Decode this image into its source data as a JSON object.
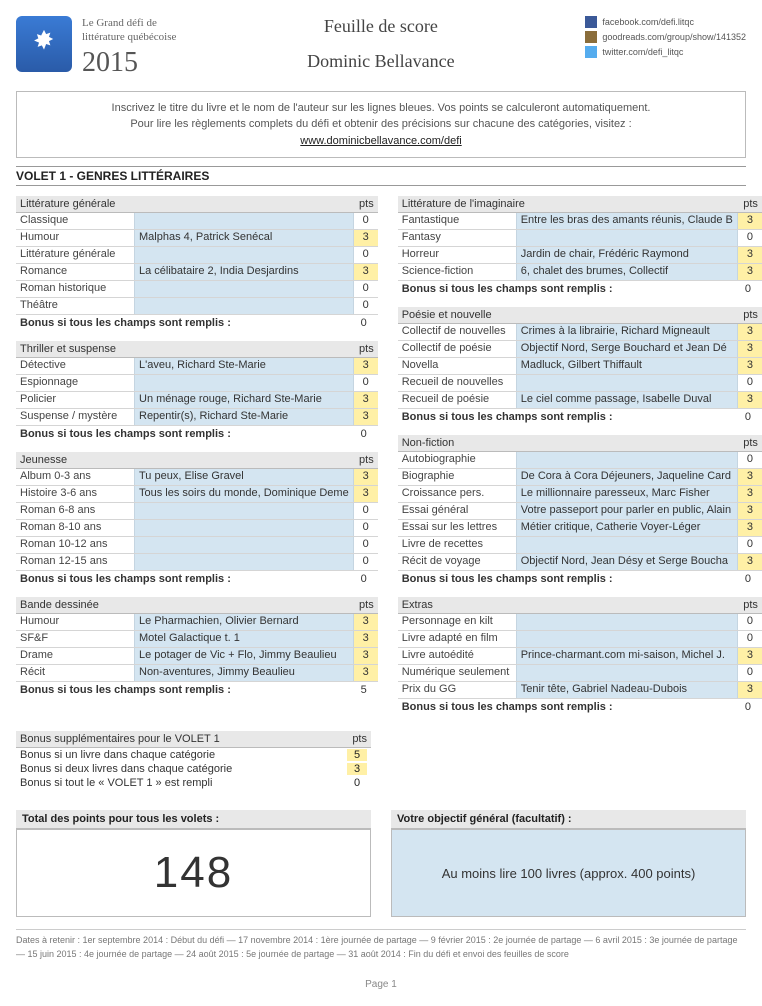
{
  "header": {
    "title1": "Le Grand défi de",
    "title2": "littérature québécoise",
    "year": "2015",
    "subtitle": "Feuille de score",
    "name": "Dominic Bellavance",
    "social": [
      {
        "icon": "fb",
        "text": "facebook.com/defi.litqc"
      },
      {
        "icon": "gr",
        "text": "goodreads.com/group/show/141352"
      },
      {
        "icon": "tw",
        "text": "twitter.com/defi_litqc"
      }
    ]
  },
  "notice": {
    "l1": "Inscrivez le titre du livre et le nom de l'auteur sur les lignes bleues. Vos points se calculeront automatiquement.",
    "l2": "Pour lire les règlements complets du défi et obtenir des précisions sur chacune des catégories, visitez :",
    "url": "www.dominicbellavance.com/defi"
  },
  "volet": "VOLET 1 - GENRES LITTÉRAIRES",
  "pts_label": "pts",
  "bonus_label": "Bonus si tous les champs sont remplis :",
  "left": [
    {
      "name": "Littérature générale",
      "rows": [
        {
          "label": "Classique",
          "val": "",
          "pts": "0"
        },
        {
          "label": "Humour",
          "val": "Malphas 4, Patrick Senécal",
          "pts": "3",
          "hl": true
        },
        {
          "label": "Littérature générale",
          "val": "",
          "pts": "0"
        },
        {
          "label": "Romance",
          "val": "La célibataire 2, India Desjardins",
          "pts": "3",
          "hl": true
        },
        {
          "label": "Roman historique",
          "val": "",
          "pts": "0"
        },
        {
          "label": "Théâtre",
          "val": "",
          "pts": "0"
        }
      ],
      "bonus": "0"
    },
    {
      "name": "Thriller et suspense",
      "rows": [
        {
          "label": "Détective",
          "val": "L'aveu, Richard Ste-Marie",
          "pts": "3",
          "hl": true
        },
        {
          "label": "Espionnage",
          "val": "",
          "pts": "0"
        },
        {
          "label": "Policier",
          "val": "Un ménage rouge, Richard Ste-Marie",
          "pts": "3",
          "hl": true
        },
        {
          "label": "Suspense / mystère",
          "val": "Repentir(s), Richard Ste-Marie",
          "pts": "3",
          "hl": true
        }
      ],
      "bonus": "0"
    },
    {
      "name": "Jeunesse",
      "rows": [
        {
          "label": "Album 0-3 ans",
          "val": "Tu peux, Elise Gravel",
          "pts": "3",
          "hl": true
        },
        {
          "label": "Histoire 3-6 ans",
          "val": "Tous les soirs du monde, Dominique Deme",
          "pts": "3",
          "hl": true
        },
        {
          "label": "Roman 6-8 ans",
          "val": "",
          "pts": "0"
        },
        {
          "label": "Roman 8-10 ans",
          "val": "",
          "pts": "0"
        },
        {
          "label": "Roman 10-12 ans",
          "val": "",
          "pts": "0"
        },
        {
          "label": "Roman 12-15 ans",
          "val": "",
          "pts": "0"
        }
      ],
      "bonus": "0"
    },
    {
      "name": "Bande dessinée",
      "rows": [
        {
          "label": "Humour",
          "val": "Le Pharmachien, Olivier Bernard",
          "pts": "3",
          "hl": true
        },
        {
          "label": "SF&F",
          "val": "Motel Galactique t. 1",
          "pts": "3",
          "hl": true
        },
        {
          "label": "Drame",
          "val": "Le potager de Vic + Flo, Jimmy Beaulieu",
          "pts": "3",
          "hl": true
        },
        {
          "label": "Récit",
          "val": "Non-aventures, Jimmy Beaulieu",
          "pts": "3",
          "hl": true
        }
      ],
      "bonus": "5"
    }
  ],
  "right": [
    {
      "name": "Littérature de l'imaginaire",
      "rows": [
        {
          "label": "Fantastique",
          "val": "Entre les bras des amants réunis, Claude B",
          "pts": "3",
          "hl": true
        },
        {
          "label": "Fantasy",
          "val": "",
          "pts": "0"
        },
        {
          "label": "Horreur",
          "val": "Jardin de chair, Frédéric Raymond",
          "pts": "3",
          "hl": true
        },
        {
          "label": "Science-fiction",
          "val": "6, chalet des brumes, Collectif",
          "pts": "3",
          "hl": true
        }
      ],
      "bonus": "0"
    },
    {
      "name": "Poésie et nouvelle",
      "rows": [
        {
          "label": "Collectif de nouvelles",
          "val": "Crimes à la librairie, Richard Migneault",
          "pts": "3",
          "hl": true
        },
        {
          "label": "Collectif de poésie",
          "val": "Objectif Nord, Serge Bouchard et Jean Dé",
          "pts": "3",
          "hl": true
        },
        {
          "label": "Novella",
          "val": "Madluck, Gilbert Thiffault",
          "pts": "3",
          "hl": true
        },
        {
          "label": "Recueil de nouvelles",
          "val": "",
          "pts": "0"
        },
        {
          "label": "Recueil de poésie",
          "val": "Le ciel comme passage, Isabelle Duval",
          "pts": "3",
          "hl": true
        }
      ],
      "bonus": "0"
    },
    {
      "name": "Non-fiction",
      "rows": [
        {
          "label": "Autobiographie",
          "val": "",
          "pts": "0"
        },
        {
          "label": "Biographie",
          "val": "De Cora à Cora Déjeuners, Jaqueline Card",
          "pts": "3",
          "hl": true
        },
        {
          "label": "Croissance pers.",
          "val": "Le millionnaire paresseux, Marc Fisher",
          "pts": "3",
          "hl": true
        },
        {
          "label": "Essai général",
          "val": "Votre passeport pour parler en public, Alain",
          "pts": "3",
          "hl": true
        },
        {
          "label": "Essai sur les lettres",
          "val": "Métier critique, Catherie Voyer-Léger",
          "pts": "3",
          "hl": true
        },
        {
          "label": "Livre de recettes",
          "val": "",
          "pts": "0"
        },
        {
          "label": "Récit de voyage",
          "val": "Objectif Nord, Jean Désy et Serge Boucha",
          "pts": "3",
          "hl": true
        }
      ],
      "bonus": "0"
    },
    {
      "name": "Extras",
      "rows": [
        {
          "label": "Personnage en kilt",
          "val": "",
          "pts": "0"
        },
        {
          "label": "Livre adapté en film",
          "val": "",
          "pts": "0"
        },
        {
          "label": "Livre autoédité",
          "val": "Prince-charmant.com mi-saison, Michel J.",
          "pts": "3",
          "hl": true
        },
        {
          "label": "Numérique seulement",
          "val": "",
          "pts": "0"
        },
        {
          "label": "Prix du GG",
          "val": "Tenir tête, Gabriel Nadeau-Dubois",
          "pts": "3",
          "hl": true
        }
      ],
      "bonus": "0"
    }
  ],
  "supp": {
    "title": "Bonus supplémentaires pour le VOLET 1",
    "rows": [
      {
        "label": "Bonus si un livre dans chaque catégorie",
        "pts": "5",
        "hl": true
      },
      {
        "label": "Bonus si deux livres dans chaque catégorie",
        "pts": "3",
        "hl": true
      },
      {
        "label": "Bonus si tout le « VOLET 1 » est rempli",
        "pts": "0"
      }
    ]
  },
  "totals": {
    "score_label": "Total des points pour tous les volets :",
    "score": "148",
    "goal_label": "Votre objectif général (facultatif) :",
    "goal": "Au moins lire 100 livres (approx. 400 points)"
  },
  "footer": "Dates à retenir : 1er septembre 2014 : Début du défi — 17 novembre 2014 : 1ère journée de partage — 9 février 2015 : 2e journée de partage — 6 avril 2015 : 3e journée de partage — 15 juin 2015 : 4e journée de partage — 24 août 2015 : 5e journée de partage — 31 août 2014 : Fin du défi et envoi des feuilles de score",
  "page": "Page 1"
}
